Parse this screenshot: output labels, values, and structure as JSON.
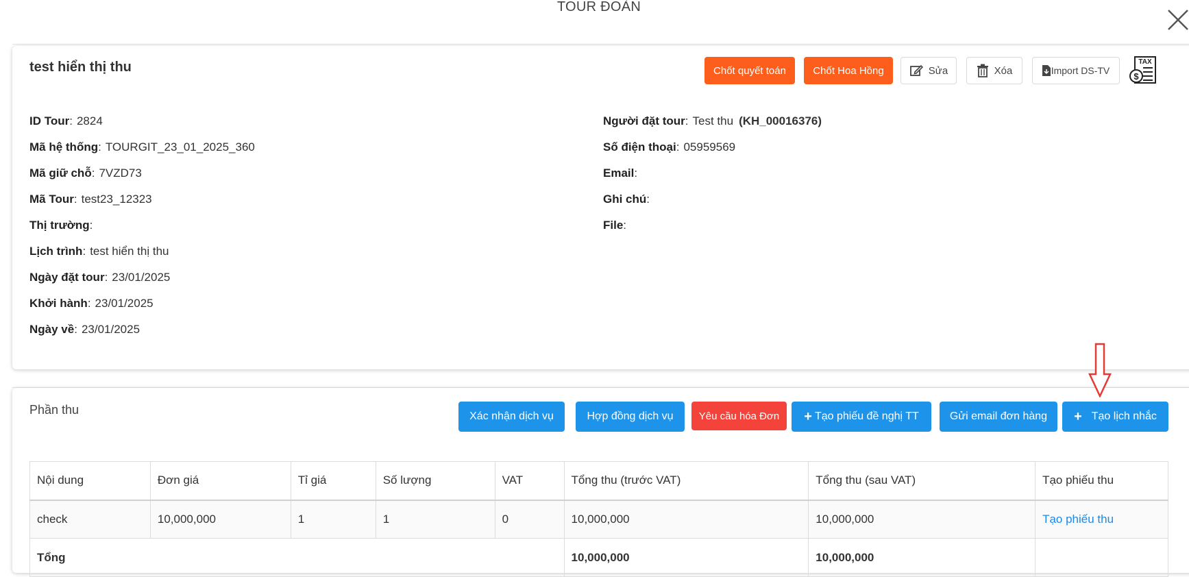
{
  "modal": {
    "title": "TOUR ĐOÀN",
    "close_icon": "close-icon"
  },
  "tour": {
    "name": "test hiển thị thu",
    "actions": {
      "settle": "Chốt quyết toán",
      "commission": "Chốt Hoa Hồng",
      "edit": "Sửa",
      "delete": "Xóa",
      "import": "Import DS-TV"
    },
    "left_fields": [
      {
        "label": "ID Tour",
        "value": "2824"
      },
      {
        "label": "Mã hệ thống",
        "value": "TOURGIT_23_01_2025_360"
      },
      {
        "label": "Mã giữ chỗ",
        "value": "7VZD73"
      },
      {
        "label": "Mã Tour",
        "value": "test23_12323"
      },
      {
        "label": "Thị trường",
        "value": ""
      },
      {
        "label": "Lịch trình",
        "value": "test hiển thị thu"
      },
      {
        "label": "Ngày đặt tour",
        "value": "23/01/2025"
      },
      {
        "label": "Khởi hành",
        "value": "23/01/2025"
      },
      {
        "label": "Ngày về",
        "value": "23/01/2025"
      }
    ],
    "right_fields": [
      {
        "label": "Người đặt tour",
        "value": "Test thu",
        "extra": "(KH_00016376)"
      },
      {
        "label": "Số điện thoại",
        "value": "05959569"
      },
      {
        "label": "Email",
        "value": ""
      },
      {
        "label": "Ghi chú",
        "value": ""
      },
      {
        "label": "File",
        "value": ""
      }
    ]
  },
  "revenue": {
    "title": "Phần thu",
    "actions": {
      "confirm_service": "Xác nhận dịch vụ",
      "service_contract": "Hợp đồng dịch vụ",
      "invoice_request": "Yêu cầu hóa Đơn",
      "payment_request": "Tạo phiếu đề nghị TT",
      "send_email": "Gửi email đơn hàng",
      "create_reminder": "Tạo lịch nhắc"
    },
    "columns": [
      "Nội dung",
      "Đơn giá",
      "Tỉ giá",
      "Số lượng",
      "VAT",
      "Tổng thu (trước VAT)",
      "Tổng thu (sau VAT)",
      "Tạo phiếu thu"
    ],
    "rows": [
      {
        "content": "check",
        "unit_price": "10,000,000",
        "rate": "1",
        "qty": "1",
        "vat": "0",
        "total_pre": "10,000,000",
        "total_post": "10,000,000",
        "action": "Tạo phiếu thu"
      }
    ],
    "total": {
      "label": "Tổng",
      "total_pre": "10,000,000",
      "total_post": "10,000,000"
    }
  },
  "colors": {
    "orange": "#fd5e1c",
    "blue": "#1e93ea",
    "red": "#f4433a",
    "link": "#1e88e5",
    "arrow": "#e53935"
  }
}
